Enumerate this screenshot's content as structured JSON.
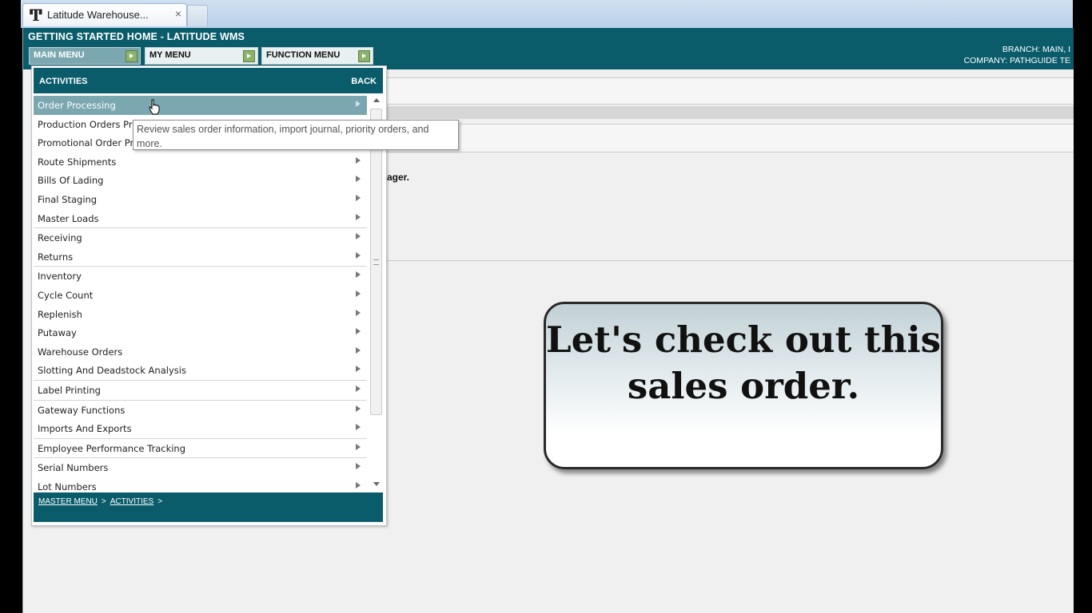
{
  "browser": {
    "tab_title": "Latitude Warehouse...",
    "tab_close": "×"
  },
  "header": {
    "title": "GETTING STARTED HOME - LATITUDE WMS",
    "menus": {
      "main": "MAIN MENU",
      "my": "MY MENU",
      "function": "FUNCTION MENU"
    },
    "branch": "BRANCH: MAIN, I",
    "company": "COMPANY: PATHGUIDE TE"
  },
  "background": {
    "partial_text": "ager."
  },
  "flyout": {
    "title": "ACTIVITIES",
    "back": "BACK",
    "items": [
      {
        "label": "Order Processing"
      },
      {
        "label": "Production Orders Pro"
      },
      {
        "label": "Promotional Order Pro"
      },
      {
        "label": "Route Shipments"
      },
      {
        "label": "Bills Of Lading"
      },
      {
        "label": "Final Staging"
      },
      {
        "label": "Master Loads"
      },
      {
        "label": "Receiving"
      },
      {
        "label": "Returns"
      },
      {
        "label": "Inventory"
      },
      {
        "label": "Cycle Count"
      },
      {
        "label": "Replenish"
      },
      {
        "label": "Putaway"
      },
      {
        "label": "Warehouse Orders"
      },
      {
        "label": "Slotting And Deadstock Analysis"
      },
      {
        "label": "Label Printing"
      },
      {
        "label": "Gateway Functions"
      },
      {
        "label": "Imports And Exports"
      },
      {
        "label": "Employee Performance Tracking"
      },
      {
        "label": "Serial Numbers"
      },
      {
        "label": "Lot Numbers"
      }
    ],
    "breadcrumb": {
      "master": "MASTER MENU",
      "activities": "ACTIVITIES",
      "sep": ">"
    }
  },
  "tooltip": {
    "text": "Review sales order information, import journal, priority orders, and more."
  },
  "callout": {
    "line1": "Let's check out this",
    "line2": "sales order."
  }
}
